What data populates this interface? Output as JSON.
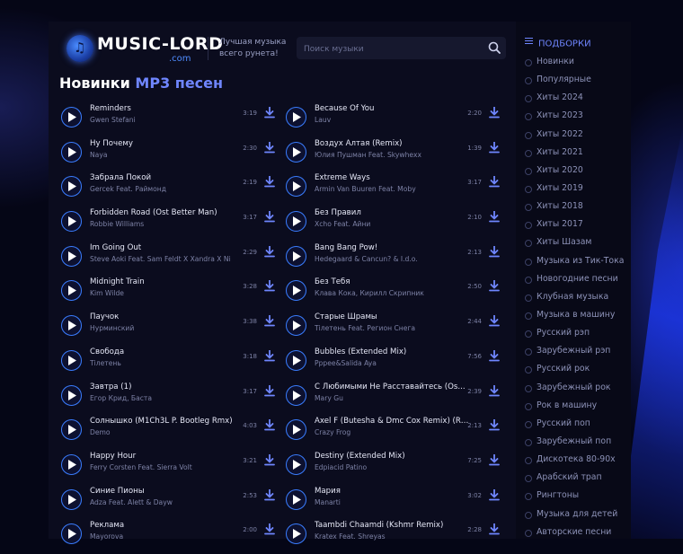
{
  "site": {
    "logo_text": "MUSIC-LORD",
    "logo_domain": ".com",
    "tagline_line1": "Лучшая музыка",
    "tagline_line2": "всего рунета!",
    "search_placeholder": "Поиск музыки"
  },
  "page": {
    "title_plain": "Новинки ",
    "title_accent": "MP3 песен"
  },
  "tracks_left": [
    {
      "title": "Reminders",
      "artist": "Gwen Stefani",
      "duration": "3:19"
    },
    {
      "title": "Ну Почему",
      "artist": "Naya",
      "duration": "2:30"
    },
    {
      "title": "Забрала Покой",
      "artist": "Gercek Feat. Раймонд",
      "duration": "2:19"
    },
    {
      "title": "Forbidden Road (Ost Better Man)",
      "artist": "Robbie Williams",
      "duration": "3:17"
    },
    {
      "title": "Im Going Out",
      "artist": "Steve Aoki Feat. Sam Feldt X Xandra X Ni",
      "duration": "2:29"
    },
    {
      "title": "Midnight Train",
      "artist": "Kim Wilde",
      "duration": "3:28"
    },
    {
      "title": "Паучок",
      "artist": "Нурминский",
      "duration": "3:38"
    },
    {
      "title": "Свобода",
      "artist": "Тілетень",
      "duration": "3:18"
    },
    {
      "title": "Завтра (1)",
      "artist": "Егор Крид, Баста",
      "duration": "3:17"
    },
    {
      "title": "Солнышко (M1Ch3L P. Bootleg Rmx)",
      "artist": "Demo",
      "duration": "4:03"
    },
    {
      "title": "Happy Hour",
      "artist": "Ferry Corsten Feat. Sierra Volt",
      "duration": "3:21"
    },
    {
      "title": "Синие Пионы",
      "artist": "Adza Feat. Alett & Dayw",
      "duration": "2:53"
    },
    {
      "title": "Реклама",
      "artist": "Mayorova",
      "duration": "2:00"
    }
  ],
  "tracks_right": [
    {
      "title": "Because Of You",
      "artist": "Lauv",
      "duration": "2:20"
    },
    {
      "title": "Воздух Алтая (Remix)",
      "artist": "Юлия Пушман Feat. Skywhexx",
      "duration": "1:39"
    },
    {
      "title": "Extreme Ways",
      "artist": "Armin Van Buuren Feat. Moby",
      "duration": "3:17"
    },
    {
      "title": "Без Правил",
      "artist": "Xcho Feat. Айни",
      "duration": "2:10"
    },
    {
      "title": "Bang Bang Pow!",
      "artist": "Hedegaard & Cancun? & I.d.o.",
      "duration": "2:13"
    },
    {
      "title": "Без Тебя",
      "artist": "Клава Кока, Кирилл Скрипник",
      "duration": "2:50"
    },
    {
      "title": "Старые Шрамы",
      "artist": "Тілетень Feat. Регион Снега",
      "duration": "2:44"
    },
    {
      "title": "Bubbles (Extended Mix)",
      "artist": "Pppee&Salida Aya",
      "duration": "7:56"
    },
    {
      "title": "С Любимыми Не Расставайтесь (Os...",
      "artist": "Mary Gu",
      "duration": "2:39"
    },
    {
      "title": "Axel F (Butesha & Dmc Cox Remix) (Ra...",
      "artist": "Crazy Frog",
      "duration": "2:13"
    },
    {
      "title": "Destiny (Extended Mix)",
      "artist": "Edpiacid Patino",
      "duration": "7:25"
    },
    {
      "title": "Мария",
      "artist": "Мanarti",
      "duration": "3:02"
    },
    {
      "title": "Taambdi Chaamdi (Kshmr Remix)",
      "artist": "Kratex Feat. Shreyas",
      "duration": "2:28"
    }
  ],
  "sidebar": {
    "heading": "ПОДБОРКИ",
    "items": [
      "Новинки",
      "Популярные",
      "Хиты 2024",
      "Хиты 2023",
      "Хиты 2022",
      "Хиты 2021",
      "Хиты 2020",
      "Хиты 2019",
      "Хиты 2018",
      "Хиты 2017",
      "Хиты Шазам",
      "Музыка из Тик-Тока",
      "Новогодние песни",
      "Клубная музыка",
      "Музыка в машину",
      "Русский рэп",
      "Зарубежный рэп",
      "Русский рок",
      "Зарубежный рок",
      "Рок в машину",
      "Русский поп",
      "Зарубежный поп",
      "Дискотека 80-90х",
      "Арабский трап",
      "Рингтоны",
      "Музыка для детей",
      "Авторские песни"
    ]
  },
  "colors": {
    "accent": "#6f86ff",
    "play_ring": "#3a7dff",
    "download": "#6f86ff"
  },
  "icons": {
    "play": "play-icon",
    "download": "download-icon",
    "search": "search-icon",
    "menu": "menu-icon"
  }
}
